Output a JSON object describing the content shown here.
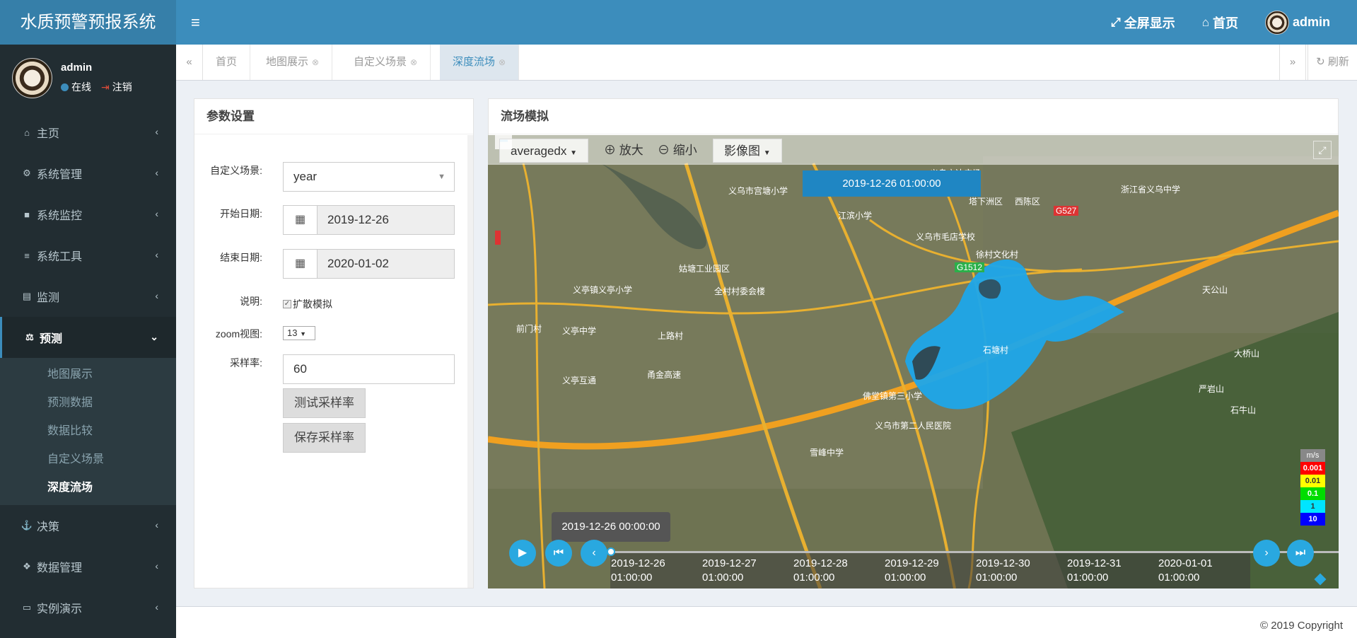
{
  "app": {
    "title": "水质预警预报系统"
  },
  "topnav": {
    "fullscreen": "全屏显示",
    "home": "首页",
    "user": "admin"
  },
  "user_panel": {
    "name": "admin",
    "status": "在线",
    "logout": "注销"
  },
  "menu": {
    "items": [
      {
        "label": "主页",
        "icon": "home-icon"
      },
      {
        "label": "系统管理",
        "icon": "gear-icon"
      },
      {
        "label": "系统监控",
        "icon": "video-camera-icon"
      },
      {
        "label": "系统工具",
        "icon": "list-icon"
      },
      {
        "label": "监测",
        "icon": "database-icon"
      },
      {
        "label": "预测",
        "icon": "balance-scale-icon"
      },
      {
        "label": "决策",
        "icon": "anchor-icon"
      },
      {
        "label": "数据管理",
        "icon": "cubes-icon"
      },
      {
        "label": "实例演示",
        "icon": "desktop-icon"
      }
    ],
    "sub": [
      "地图展示",
      "预测数据",
      "数据比较",
      "自定义场景",
      "深度流场"
    ]
  },
  "tabs": [
    "首页",
    "地图展示",
    "自定义场景",
    "深度流场"
  ],
  "tabs_refresh": "刷新",
  "params": {
    "title": "参数设置",
    "scene_label": "自定义场景:",
    "scene_value": "year",
    "start_label": "开始日期:",
    "start_value": "2019-12-26",
    "end_label": "结束日期:",
    "end_value": "2020-01-02",
    "desc_label": "说明:",
    "desc_checkbox": "扩散模拟",
    "zoom_label": "zoom视图:",
    "zoom_value": "13",
    "rate_label": "采样率:",
    "rate_value": "60",
    "test_btn": "测试采样率",
    "save_btn": "保存采样率"
  },
  "flow": {
    "title": "流场模拟",
    "layer_select": "averagedx",
    "zoom_in": "放大",
    "zoom_out": "缩小",
    "basemap": "影像图",
    "current_time": "2019-12-26 01:00:00",
    "tooltip_time": "2019-12-26 00:00:00",
    "timeline": [
      {
        "d": "2019-12-26",
        "t": "01:00:00"
      },
      {
        "d": "2019-12-27",
        "t": "01:00:00"
      },
      {
        "d": "2019-12-28",
        "t": "01:00:00"
      },
      {
        "d": "2019-12-29",
        "t": "01:00:00"
      },
      {
        "d": "2019-12-30",
        "t": "01:00:00"
      },
      {
        "d": "2019-12-31",
        "t": "01:00:00"
      },
      {
        "d": "2020-01-01",
        "t": "01:00:00"
      }
    ],
    "legend": {
      "unit": "m/s",
      "values": [
        "0.001",
        "0.01",
        "0.1",
        "1",
        "10"
      ],
      "colors": [
        "#ff0000",
        "#ffff00",
        "#00dd00",
        "#00e5ff",
        "#0000ff"
      ]
    },
    "map_labels": [
      "义乌方达广场",
      "义乌市宫塘小学",
      "江滨小学",
      "塔下洲区",
      "西陈区",
      "浙江省义乌中学",
      "义乌市毛店学校",
      "徐村文化村",
      "佛堂镇第三小学",
      "义乌市第二人民医院",
      "雪峰中学",
      "义亭中学",
      "义亭镇义亭小学",
      "姑塘工业园区",
      "全村村委会楼",
      "石牛山",
      "严岩山",
      "大桥山",
      "天公山",
      "义亭互通",
      "甬金高速",
      "G1512",
      "G527",
      "前门村",
      "上路村",
      "石塘村"
    ]
  },
  "footer": {
    "copyright": "© 2019 Copyright"
  }
}
